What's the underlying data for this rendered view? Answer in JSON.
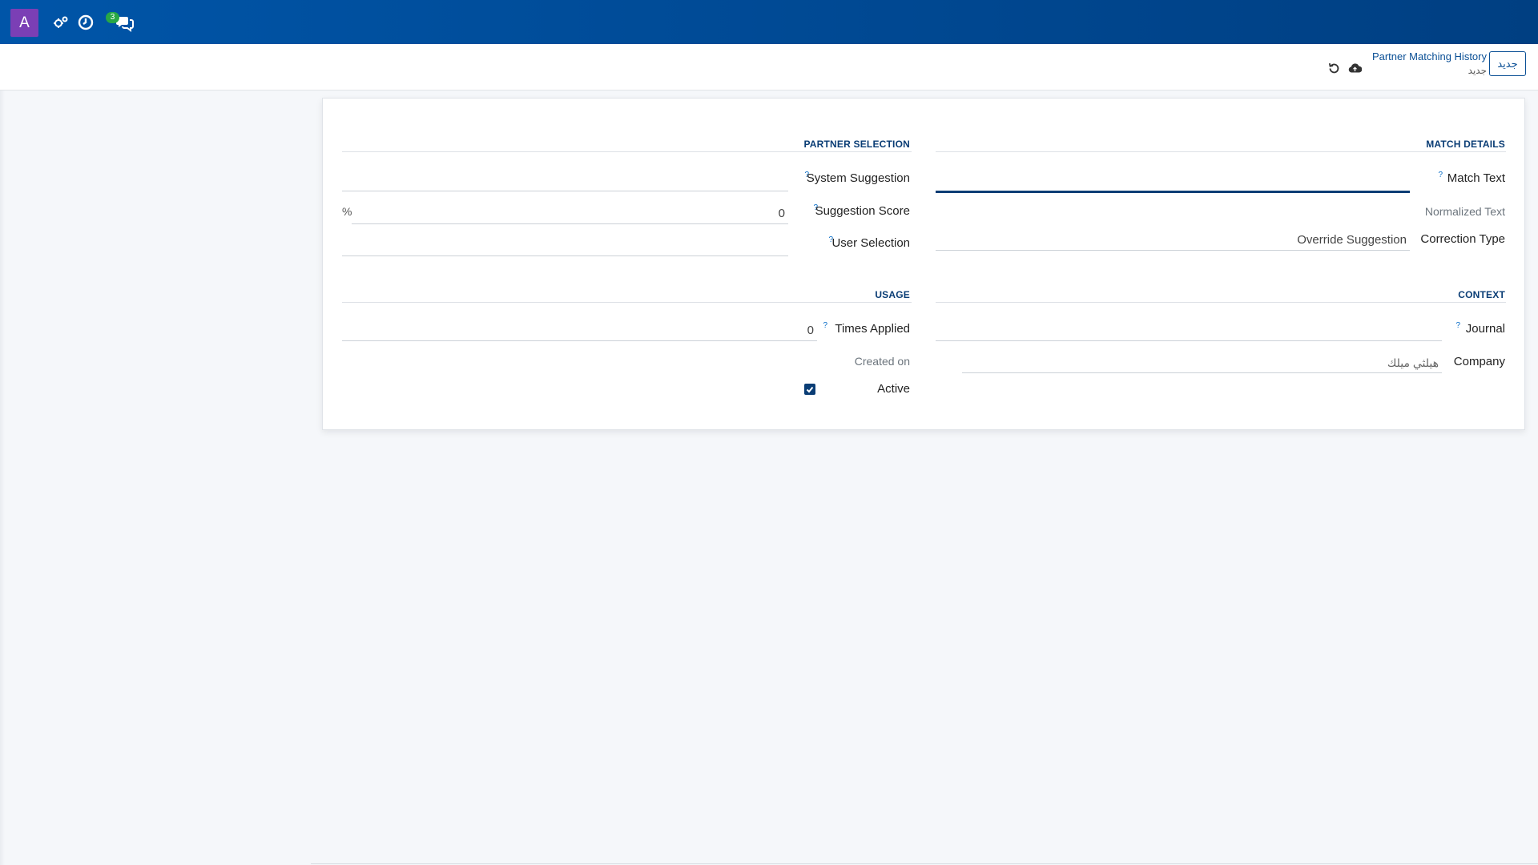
{
  "navbar": {
    "avatar_letter": "A",
    "icons": [
      "manage-icon",
      "clock-icon",
      "chat-icon"
    ],
    "chat_badge": "3",
    "background_color": "#0055a8"
  },
  "control_panel": {
    "new_button_label": "جديد",
    "breadcrumb_parent": "Partner Matching History",
    "breadcrumb_current": "جديد",
    "icons": [
      "upload-icon",
      "undo-icon"
    ]
  },
  "form": {
    "sections": {
      "match_details": "MATCH DETAILS",
      "partner_selection": "PARTNER SELECTION",
      "context": "CONTEXT",
      "usage": "USAGE"
    },
    "match_text": {
      "label": "Match Text",
      "help": "?",
      "value": ""
    },
    "normalized_text": {
      "label": "Normalized Text"
    },
    "correction_type": {
      "label": "Correction Type",
      "value": "Override Suggestion"
    },
    "system_suggestion": {
      "label": "System Suggestion",
      "help": "?",
      "value": ""
    },
    "suggestion_score": {
      "label": "Suggestion Score",
      "help": "?",
      "value": "0",
      "unit": "%"
    },
    "user_selection": {
      "label": "User Selection",
      "help": "?",
      "value": ""
    },
    "journal": {
      "label": "Journal",
      "help": "?",
      "value": ""
    },
    "company": {
      "label": "Company",
      "value": "هيلثي ميلك"
    },
    "times_applied": {
      "label": "Times Applied",
      "help": "?",
      "value": "0"
    },
    "created_on": {
      "label": "Created on"
    },
    "active": {
      "label": "Active",
      "checked": true
    }
  },
  "colors": {
    "accent": "#0a3d75",
    "link": "#0a4f95",
    "badge": "#28a745",
    "avatar": "#7b3fb5"
  }
}
